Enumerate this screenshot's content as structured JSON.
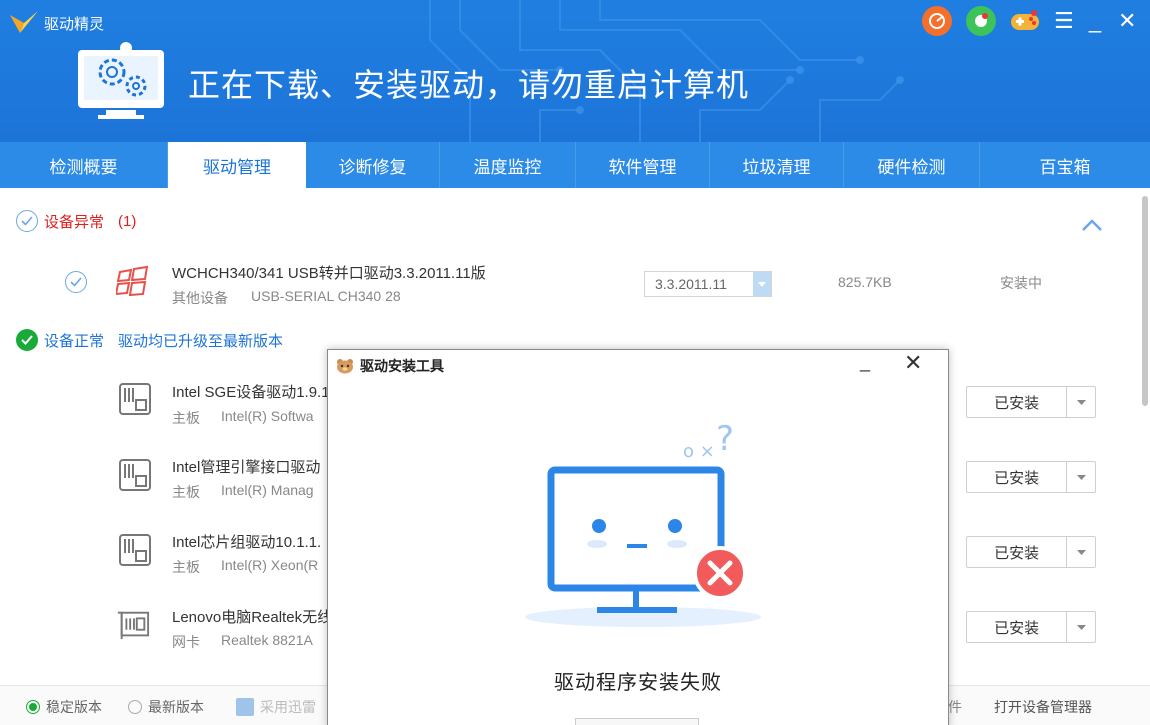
{
  "app": {
    "name": "驱动精灵"
  },
  "header": {
    "title": "正在下载、安装驱动，请勿重启计算机"
  },
  "window_controls": {
    "menu": "☰",
    "minimize": "_",
    "close": "✕"
  },
  "tabs": [
    {
      "label": "检测概要"
    },
    {
      "label": "驱动管理"
    },
    {
      "label": "诊断修复"
    },
    {
      "label": "温度监控"
    },
    {
      "label": "软件管理"
    },
    {
      "label": "垃圾清理"
    },
    {
      "label": "硬件检测"
    },
    {
      "label": "百宝箱"
    }
  ],
  "abnormal": {
    "label": "设备异常",
    "count": "(1)",
    "device": {
      "title": "WCHCH340/341 USB转并口驱动3.3.2011.11版",
      "category": "其他设备",
      "hardware": "USB-SERIAL CH340   28",
      "version": "3.3.2011.11",
      "size": "825.7KB",
      "status": "安装中"
    }
  },
  "normal": {
    "label": "设备正常",
    "desc": "驱动均已升级至最新版本",
    "devices": [
      {
        "title": "Intel SGE设备驱动1.9.1",
        "category": "主板",
        "hardware": "Intel(R) Softwa",
        "button": "已安装"
      },
      {
        "title": "Intel管理引擎接口驱动",
        "category": "主板",
        "hardware": "Intel(R) Manag",
        "button": "已安装"
      },
      {
        "title": "Intel芯片组驱动10.1.1.",
        "category": "主板",
        "hardware": "Intel(R) Xeon(R",
        "button": "已安装"
      },
      {
        "title": "Lenovo电脑Realtek无线",
        "category": "网卡",
        "hardware": "Realtek 8821A",
        "button": "已安装"
      }
    ]
  },
  "footer": {
    "stable": "稳定版本",
    "latest": "最新版本",
    "xunlei": "采用迅雷",
    "partial": "件",
    "open_manager": "打开设备管理器"
  },
  "dialog": {
    "title": "驱动安装工具",
    "minimize": "_",
    "close": "✕",
    "message": "驱动程序安装失败",
    "question": "? ",
    "art_marks": "o ×"
  },
  "colors": {
    "brand": "#1d74d8",
    "tabbar": "#2b8be6",
    "error": "#f15b5b",
    "ok": "#1aaa3a",
    "warn": "#e02020"
  }
}
